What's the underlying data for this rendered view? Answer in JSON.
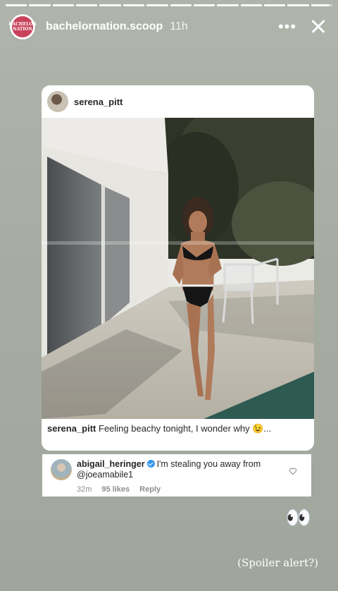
{
  "header": {
    "username": "bachelornation.scoop",
    "timestamp": "11h",
    "avatar_text": "BACHELOR NATION",
    "more_glyph": "•••"
  },
  "progress": {
    "segments": 14,
    "current_segment": 13,
    "current_fill": 0.85
  },
  "post": {
    "username": "serena_pitt",
    "caption_user": "serena_pitt",
    "caption_text": "Feeling beachy tonight, I wonder why 😉..."
  },
  "comment": {
    "username": "abigail_heringer",
    "text_line1": "I'm stealing you away from",
    "mention": "@joeamabile1",
    "age": "32m",
    "likes": "95 likes",
    "reply": "Reply"
  },
  "sticker": {
    "eyes": "👀"
  },
  "overlay_text": "(Spoiler alert?)",
  "icons": [
    "more-icon",
    "close-icon",
    "verified-icon",
    "heart-icon"
  ],
  "colors": {
    "background": "#a6aba2",
    "verified": "#3897f0",
    "meta_gray": "#8e8e8e"
  }
}
